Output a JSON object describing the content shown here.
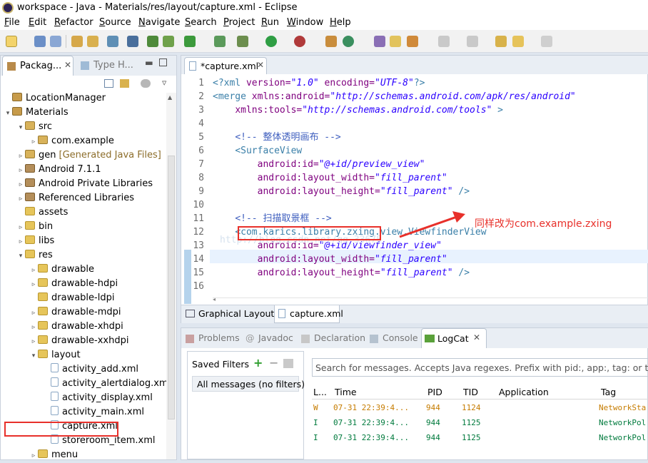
{
  "window": {
    "title": "workspace - Java - Materials/res/layout/capture.xml - Eclipse"
  },
  "menu": [
    "File",
    "Edit",
    "Refactor",
    "Source",
    "Navigate",
    "Search",
    "Project",
    "Run",
    "Window",
    "Help"
  ],
  "package_explorer": {
    "tabs": [
      "Packag...",
      "Type H..."
    ],
    "items": [
      {
        "label": "LocationManager",
        "depth": 0,
        "twist": "",
        "icon": "project-icon"
      },
      {
        "label": "Materials",
        "depth": 0,
        "twist": "▾",
        "icon": "project-icon"
      },
      {
        "label": "src",
        "depth": 1,
        "twist": "▾",
        "icon": "package-folder-icon"
      },
      {
        "label": "com.example",
        "depth": 2,
        "twist": "▹",
        "icon": "package-icon"
      },
      {
        "label": "gen",
        "extra": "[Generated Java Files]",
        "depth": 1,
        "twist": "▹",
        "icon": "package-folder-icon"
      },
      {
        "label": "Android 7.1.1",
        "depth": 1,
        "twist": "▹",
        "icon": "library-icon"
      },
      {
        "label": "Android Private Libraries",
        "depth": 1,
        "twist": "▹",
        "icon": "library-icon"
      },
      {
        "label": "Referenced Libraries",
        "depth": 1,
        "twist": "▹",
        "icon": "library-icon"
      },
      {
        "label": "assets",
        "depth": 1,
        "twist": "",
        "icon": "folder-icon"
      },
      {
        "label": "bin",
        "depth": 1,
        "twist": "▹",
        "icon": "folder-icon"
      },
      {
        "label": "libs",
        "depth": 1,
        "twist": "▹",
        "icon": "folder-icon"
      },
      {
        "label": "res",
        "depth": 1,
        "twist": "▾",
        "icon": "folder-icon"
      },
      {
        "label": "drawable",
        "depth": 2,
        "twist": "▹",
        "icon": "folder-icon"
      },
      {
        "label": "drawable-hdpi",
        "depth": 2,
        "twist": "▹",
        "icon": "folder-icon"
      },
      {
        "label": "drawable-ldpi",
        "depth": 2,
        "twist": "",
        "icon": "folder-icon"
      },
      {
        "label": "drawable-mdpi",
        "depth": 2,
        "twist": "▹",
        "icon": "folder-icon"
      },
      {
        "label": "drawable-xhdpi",
        "depth": 2,
        "twist": "▹",
        "icon": "folder-icon"
      },
      {
        "label": "drawable-xxhdpi",
        "depth": 2,
        "twist": "▹",
        "icon": "folder-icon"
      },
      {
        "label": "layout",
        "depth": 2,
        "twist": "▾",
        "icon": "folder-icon"
      },
      {
        "label": "activity_add.xml",
        "depth": 3,
        "twist": "",
        "icon": "xml-file-icon"
      },
      {
        "label": "activity_alertdialog.xml",
        "depth": 3,
        "twist": "",
        "icon": "xml-file-icon"
      },
      {
        "label": "activity_display.xml",
        "depth": 3,
        "twist": "",
        "icon": "xml-file-icon"
      },
      {
        "label": "activity_main.xml",
        "depth": 3,
        "twist": "",
        "icon": "xml-file-icon"
      },
      {
        "label": "capture.xml",
        "depth": 3,
        "twist": "",
        "icon": "xml-file-icon"
      },
      {
        "label": "storeroom_item.xml",
        "depth": 3,
        "twist": "",
        "icon": "xml-file-icon"
      },
      {
        "label": "menu",
        "depth": 2,
        "twist": "▹",
        "icon": "folder-icon"
      }
    ]
  },
  "editor": {
    "tab": "*capture.xml",
    "line_numbers": [
      "1",
      "2",
      "3",
      "4",
      "5",
      "6",
      "7",
      "8",
      "9",
      "10",
      "11",
      "12",
      "13",
      "14",
      "15",
      "16"
    ],
    "code": {
      "l1": {
        "a": "<?xml ",
        "b": "version=",
        "c": "\"1.0\"",
        "d": " encoding=",
        "e": "\"UTF-8\"",
        "f": "?>"
      },
      "l2": {
        "a": "<merge ",
        "b": "xmlns:android=",
        "c": "\"http://schemas.android.com/apk/res/android\""
      },
      "l3": {
        "pad": "    ",
        "b": "xmlns:tools=",
        "c": "\"http://schemas.android.com/tools\"",
        "d": " >"
      },
      "l5": {
        "pad": "    ",
        "a": "<!-- 整体透明画布 -->"
      },
      "l6": {
        "pad": "    ",
        "a": "<SurfaceView"
      },
      "l7": {
        "pad": "        ",
        "b": "android:id=",
        "c": "\"@+id/preview_view\""
      },
      "l8": {
        "pad": "        ",
        "b": "android:layout_width=",
        "c": "\"fill_parent\""
      },
      "l9": {
        "pad": "        ",
        "b": "android:layout_height=",
        "c": "\"fill_parent\"",
        "d": " />"
      },
      "l11": {
        "pad": "    ",
        "a": "<!-- 扫描取景框 -->"
      },
      "l12": {
        "pad": "    ",
        "lt": "<",
        "a": "com.karics.library.zxing",
        "b": ".view.ViewfinderView"
      },
      "l13": {
        "pad": "        ",
        "b": "android:id=",
        "c": "\"@+id/viewfinder_view\""
      },
      "l14": {
        "pad": "        ",
        "b": "android:layout_width=",
        "c": "\"fill_parent\""
      },
      "l15": {
        "pad": "        ",
        "b": "android:layout_height=",
        "c": "\"fill_parent\"",
        "d": " />"
      }
    },
    "annotation": "同样改为com.example.zxing",
    "watermark": "http://blog.csdn.net/qq_33675",
    "bottom_tabs": [
      "Graphical Layout",
      "capture.xml"
    ]
  },
  "bottom": {
    "tabs": [
      "Problems",
      "Javadoc",
      "Declaration",
      "Console",
      "LogCat"
    ],
    "saved_filters": "Saved Filters",
    "all_messages": "All messages (no filters)",
    "search_placeholder": "Search for messages. Accepts Java regexes. Prefix with pid:, app:, tag: or text: to",
    "columns": [
      "L...",
      "Time",
      "PID",
      "TID",
      "Application",
      "Tag"
    ],
    "rows": [
      {
        "level": "W",
        "time": "07-31 22:39:4...",
        "pid": "944",
        "tid": "1124",
        "app": "",
        "tag": "NetworkSta",
        "color": "#c67c00"
      },
      {
        "level": "I",
        "time": "07-31 22:39:4...",
        "pid": "944",
        "tid": "1125",
        "app": "",
        "tag": "NetworkPol",
        "color": "#007a3d"
      },
      {
        "level": "I",
        "time": "07-31 22:39:4...",
        "pid": "944",
        "tid": "1125",
        "app": "",
        "tag": "NetworkPol",
        "color": "#007a3d"
      }
    ]
  },
  "colors": {
    "annotation_red": "#e8302a",
    "tag_blue": "#3a7fa8",
    "attr_purple": "#7f007f",
    "string_blue": "#2a00ff",
    "comment_blue": "#3f5fbf"
  }
}
